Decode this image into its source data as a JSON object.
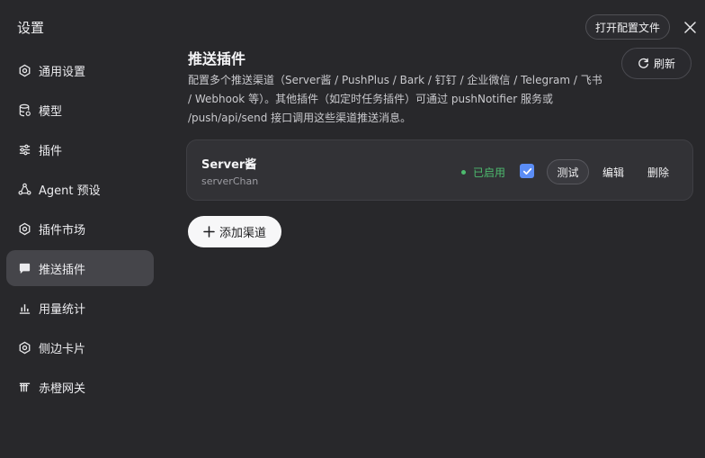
{
  "header": {
    "title": "设置",
    "open_config_label": "打开配置文件"
  },
  "sidebar": {
    "items": [
      {
        "label": "通用设置",
        "icon": "gear-icon"
      },
      {
        "label": "模型",
        "icon": "database-icon"
      },
      {
        "label": "插件",
        "icon": "sliders-icon"
      },
      {
        "label": "Agent 预设",
        "icon": "agent-icon"
      },
      {
        "label": "插件市场",
        "icon": "gear-icon"
      },
      {
        "label": "推送插件",
        "icon": "chat-icon",
        "active": true
      },
      {
        "label": "用量统计",
        "icon": "bar-chart-icon"
      },
      {
        "label": "侧边卡片",
        "icon": "gear-icon"
      },
      {
        "label": "赤橙网关",
        "icon": "gateway-icon"
      }
    ]
  },
  "main": {
    "heading": "推送插件",
    "description": "配置多个推送渠道（Server酱 / PushPlus / Bark / 钉钉 / 企业微信 / Telegram / 飞书 / Webhook 等）。其他插件（如定时任务插件）可通过 pushNotifier 服务或 /push/api/send 接口调用这些渠道推送消息。",
    "refresh_label": "刷新",
    "add_channel_label": "添加渠道",
    "channels": [
      {
        "name": "Server酱",
        "id": "serverChan",
        "status": "已启用",
        "enabled": true,
        "test_label": "测试",
        "edit_label": "编辑",
        "delete_label": "删除"
      }
    ]
  },
  "colors": {
    "background": "#28282b",
    "active_nav": "#45454a",
    "status_green": "#4dbb6e",
    "checkbox_blue": "#5b8df6"
  }
}
